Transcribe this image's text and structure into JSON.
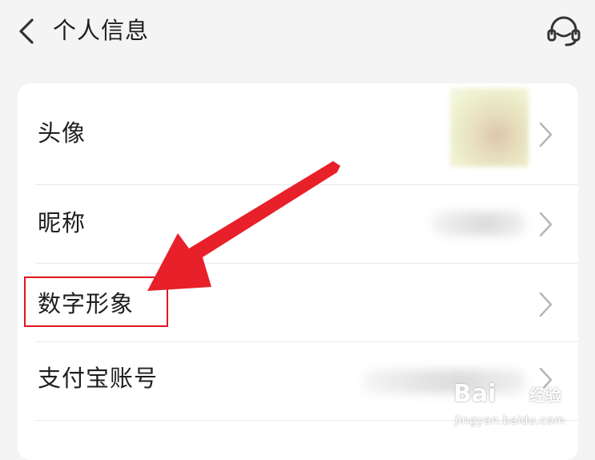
{
  "header": {
    "title": "个人信息",
    "back_icon": "chevron-left-icon",
    "service_icon": "headset-icon"
  },
  "rows": [
    {
      "label": "头像",
      "value_type": "avatar-image"
    },
    {
      "label": "昵称",
      "value_type": "blurred-text"
    },
    {
      "label": "数字形象",
      "value_type": "none"
    },
    {
      "label": "支付宝账号",
      "value_type": "blurred-text"
    }
  ],
  "annotation": {
    "highlight_color": "#e2161f",
    "arrow_color": "#e8202a"
  },
  "watermark": {
    "brand": "Bai",
    "jingyan": "经验",
    "url": "jingyan.baidu.com"
  }
}
